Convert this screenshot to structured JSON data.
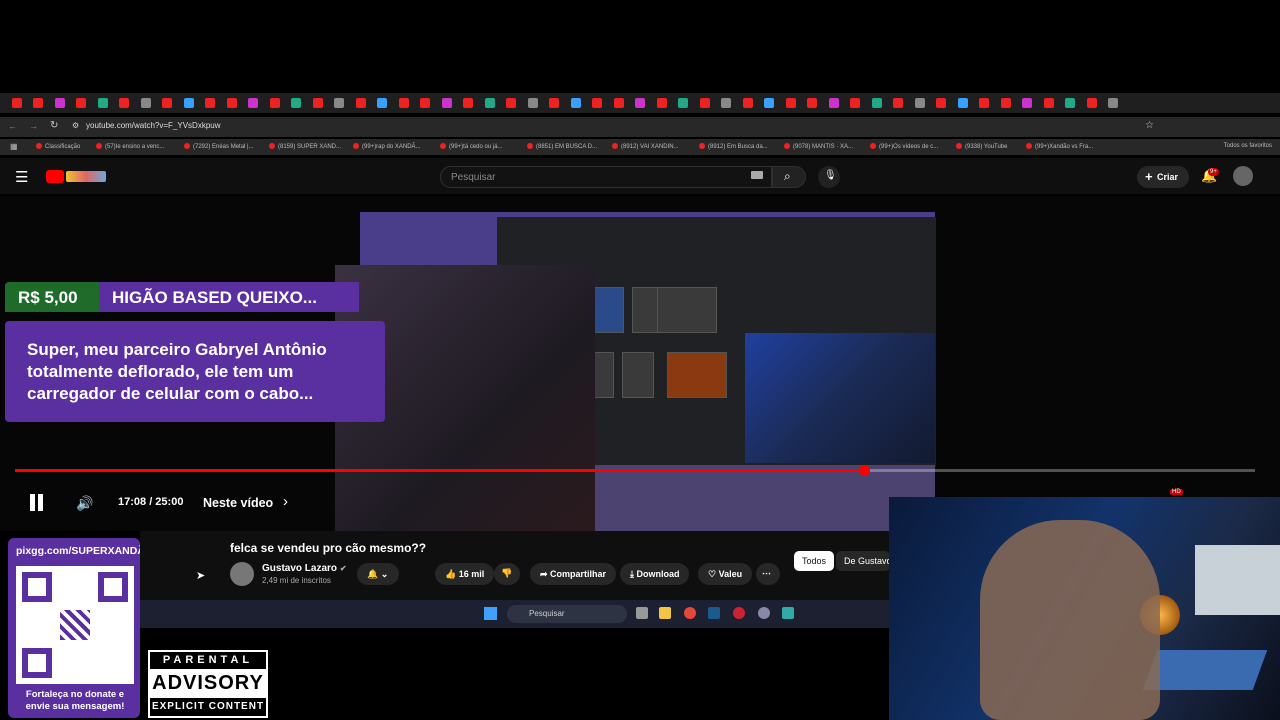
{
  "browser": {
    "url": "youtube.com/watch?v=F_YVsDxkpuw",
    "bookmarks": [
      "Classificação",
      "(57)Ie ensino a venc...",
      "(7292) Enéas Metal |...",
      "(8159) SUPER XAND...",
      "(99+)rap do XANDÃ...",
      "(99+)tá cedo ou já...",
      "(8851) EM BUSCA D...",
      "(8912) VAI XANDIN...",
      "(8912) Em Busca da...",
      "(9078) MANTIS · XA...",
      "(99+)Os vídeos de c...",
      "(9338) YouTube",
      "(99+)Xandão vs Fra..."
    ],
    "all_favorites": "Todos os favoritos"
  },
  "youtube": {
    "search_placeholder": "Pesquisar",
    "create_label": "Criar",
    "notification_badge": "9+",
    "hd_badge": "HD"
  },
  "superchat": {
    "price": "R$ 5,00",
    "name": "HIGÃO BASED QUEIXO...",
    "message": "Super, meu parceiro Gabryel Antônio totalmente deflorado, ele tem um carregador de celular com o cabo..."
  },
  "player": {
    "time": "17:08 / 25:00",
    "chapters_label": "Neste vídeo",
    "progress": 0.685
  },
  "video": {
    "title": "felca se vendeu pro cão mesmo??",
    "channel": "Gustavo Lazaro",
    "subscribers": "2,49 mi de inscritos",
    "likes": "16 mil",
    "share": "Compartilhar",
    "download": "Download",
    "thanks": "Valeu",
    "filters": [
      "Todos",
      "De Gustavo"
    ]
  },
  "taskbar": {
    "search_placeholder": "Pesquisar"
  },
  "overlay": {
    "donate_url": "pixgg.com/SUPERXANDÃO",
    "donate_message": "Fortaleça no donate e envie sua mensagem!",
    "advisory_top": "PARENTAL",
    "advisory_mid": "ADVISORY",
    "advisory_bot": "EXPLICIT CONTENT"
  },
  "colors": {
    "accent_red": "#ff0000",
    "superchat_green": "#1f6b2a",
    "superchat_purple": "#5a2fa0"
  }
}
